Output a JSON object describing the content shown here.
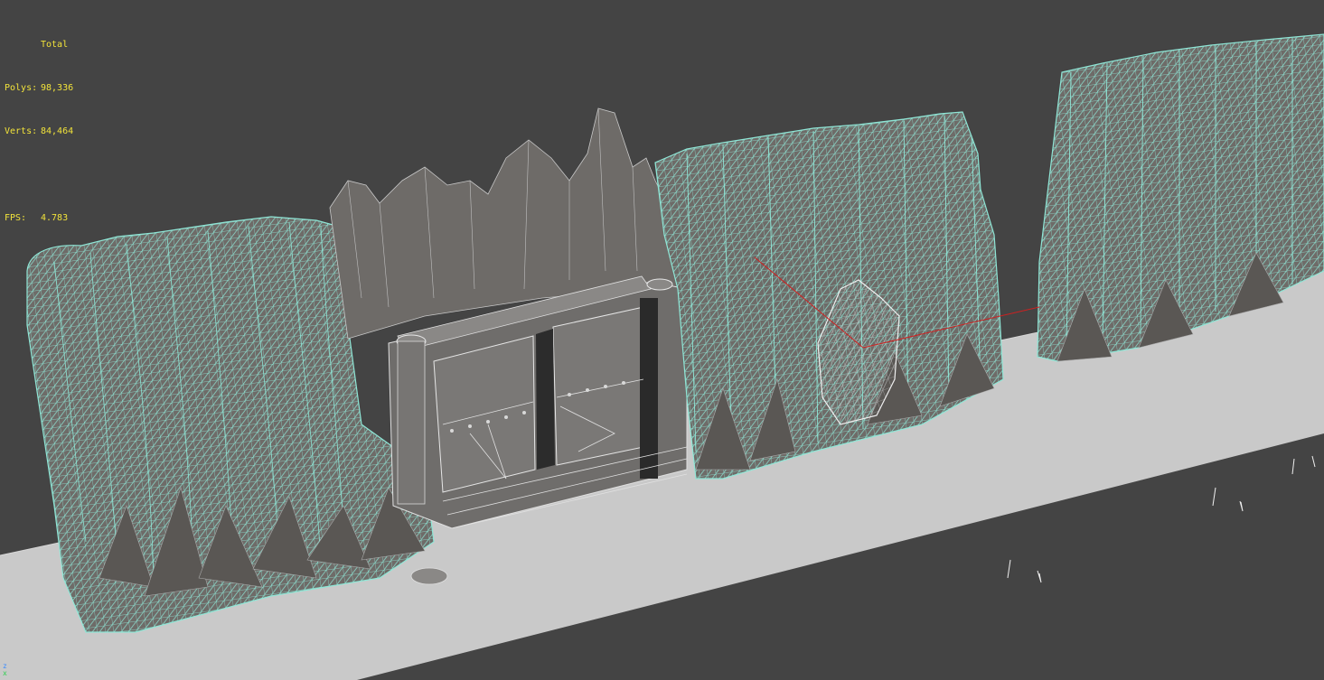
{
  "viewport": {
    "background_color": "#444444",
    "stats": {
      "header": "Total",
      "polys_label": "Polys:",
      "polys_value": "98,336",
      "verts_label": "Verts:",
      "verts_value": "84,464",
      "fps_label": "FPS:",
      "fps_value": "4.783",
      "text_color": "#f2e33a"
    },
    "axis_gizmo": {
      "z_label": "z",
      "x_label": "x"
    },
    "colors": {
      "ground": "#c9c9c9",
      "mesh_fill": "#6e6b68",
      "mesh_dark": "#4e4b48",
      "wire_selected": "#8fe6d6",
      "wire_white": "#e8e8e8",
      "red_line": "#d02020"
    }
  }
}
